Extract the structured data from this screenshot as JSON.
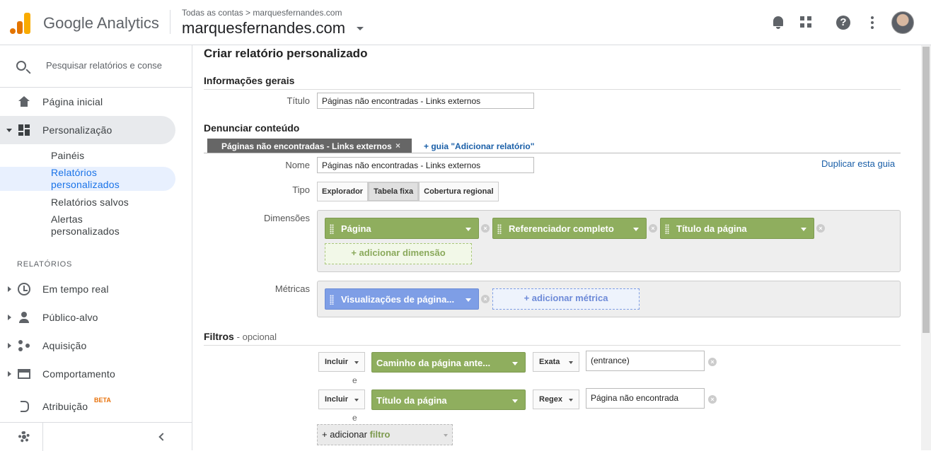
{
  "topbar": {
    "brand": "Google Analytics",
    "breadcrumb": "Todas as contas > marquesfernandes.com",
    "account": "marquesfernandes.com"
  },
  "sidebar": {
    "search_placeholder": "Pesquisar relatórios e conse",
    "home": "Página inicial",
    "customization": "Personalização",
    "sub_items": [
      "Painéis",
      "Relatórios personalizados",
      "Relatórios salvos",
      "Alertas personalizados"
    ],
    "reports_header": "RELATÓRIOS",
    "reports": [
      "Em tempo real",
      "Público-alvo",
      "Aquisição",
      "Comportamento",
      "Atribuição"
    ],
    "beta": "BETA"
  },
  "main": {
    "page_title": "Criar relatório personalizado",
    "general_info": "Informações gerais",
    "title_label": "Título",
    "title_value": "Páginas não encontradas - Links externos",
    "report_content": "Denunciar conteúdo",
    "tab_name": "Páginas não encontradas - Links externos",
    "tab_close": "×",
    "add_tab": "+ guia \"Adicionar relatório\"",
    "duplicate_tab": "Duplicar esta guia",
    "name_label": "Nome",
    "name_value": "Páginas não encontradas - Links externos",
    "type_label": "Tipo",
    "types": [
      "Explorador",
      "Tabela fixa",
      "Cobertura regional"
    ],
    "selected_type": "Tabela fixa",
    "dimensions_label": "Dimensões",
    "dimensions": [
      "Página",
      "Referenciador completo",
      "Título da página"
    ],
    "add_dimension": "+ adicionar dimensão",
    "metrics_label": "Métricas",
    "metrics": [
      "Visualizações de página..."
    ],
    "add_metric": "+ adicionar métrica",
    "filters_label": "Filtros",
    "filters_optional": "- opcional",
    "filters": [
      {
        "include": "Incluir",
        "dimension": "Caminho da página ante...",
        "match": "Exata",
        "value": "(entrance)"
      },
      {
        "include": "Incluir",
        "dimension": "Título da página",
        "match": "Regex",
        "value": "Página não encontrada"
      }
    ],
    "and_label": "e",
    "add_filter_prefix": "+ adicionar",
    "add_filter_word": "filtro"
  },
  "colors": {
    "dimension_chip": "#8fae5e",
    "metric_chip": "#7e9ee6",
    "link": "#1a5fa8",
    "brand_orange": "#f9ab00"
  }
}
